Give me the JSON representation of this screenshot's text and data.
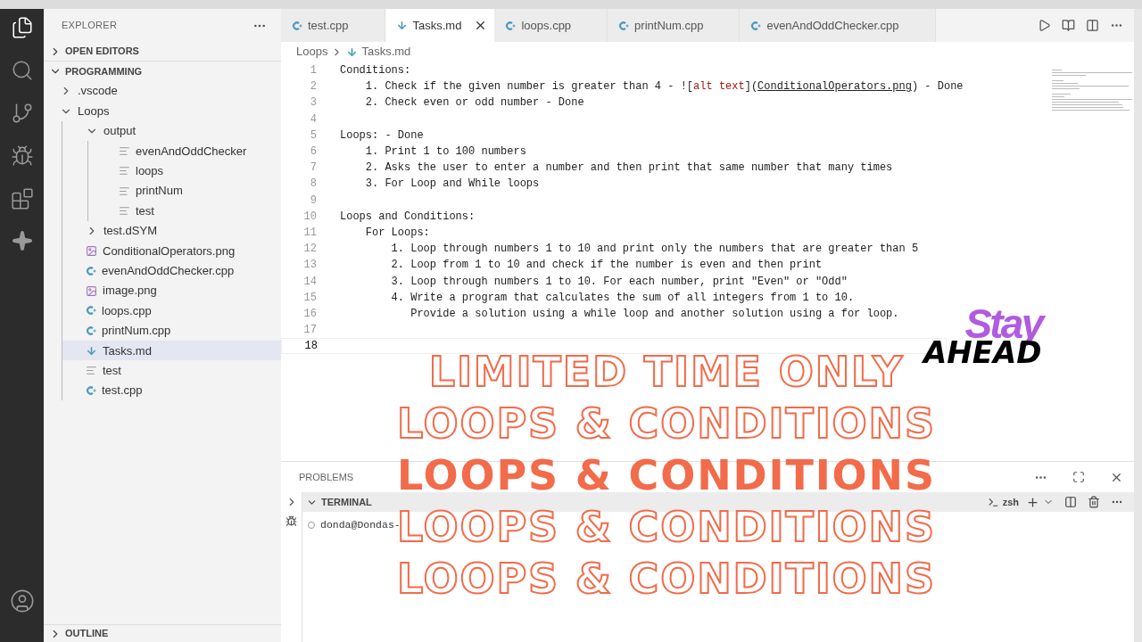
{
  "sidebar": {
    "title": "EXPLORER",
    "sections": [
      {
        "label": "OPEN EDITORS",
        "expanded": false
      },
      {
        "label": "PROGRAMMING",
        "expanded": true
      }
    ],
    "tree": [
      {
        "label": ".vscode",
        "kind": "folder",
        "expanded": false,
        "selected": false
      },
      {
        "label": "Loops",
        "kind": "folder",
        "expanded": true,
        "selected": false,
        "children": [
          {
            "label": "output",
            "kind": "folder",
            "expanded": true,
            "selected": false,
            "children": [
              {
                "label": "evenAndOddChecker",
                "kind": "text",
                "selected": false
              },
              {
                "label": "loops",
                "kind": "text",
                "selected": false
              },
              {
                "label": "printNum",
                "kind": "text",
                "selected": false
              },
              {
                "label": "test",
                "kind": "text",
                "selected": false
              }
            ]
          },
          {
            "label": "test.dSYM",
            "kind": "folder",
            "expanded": false,
            "selected": false
          },
          {
            "label": "ConditionalOperators.png",
            "kind": "image",
            "selected": false
          },
          {
            "label": "evenAndOddChecker.cpp",
            "kind": "cpp",
            "selected": false
          },
          {
            "label": "image.png",
            "kind": "image",
            "selected": false
          },
          {
            "label": "loops.cpp",
            "kind": "cpp",
            "selected": false
          },
          {
            "label": "printNum.cpp",
            "kind": "cpp",
            "selected": false
          },
          {
            "label": "Tasks.md",
            "kind": "markdown",
            "selected": true
          },
          {
            "label": "test",
            "kind": "text",
            "selected": false
          },
          {
            "label": "test.cpp",
            "kind": "cpp",
            "selected": false
          }
        ]
      }
    ],
    "outline": {
      "label": "OUTLINE",
      "expanded": false
    }
  },
  "tabs": [
    {
      "label": "test.cpp",
      "kind": "cpp",
      "selected": false
    },
    {
      "label": "Tasks.md",
      "kind": "markdown",
      "selected": true
    },
    {
      "label": "loops.cpp",
      "kind": "cpp",
      "selected": false
    },
    {
      "label": "printNum.cpp",
      "kind": "cpp",
      "selected": false
    },
    {
      "label": "evenAndOddChecker.cpp",
      "kind": "cpp",
      "selected": false
    }
  ],
  "breadcrumb": [
    {
      "label": "Loops",
      "kind": "folder"
    },
    {
      "label": "Tasks.md",
      "kind": "markdown"
    }
  ],
  "editor": {
    "lines": [
      {
        "number": "1",
        "segments": [
          {
            "kind": "plain",
            "text": "Conditions:"
          }
        ]
      },
      {
        "number": "2",
        "segments": [
          {
            "kind": "plain",
            "text": "    1. Check if the given number is greater than 4 - !["
          },
          {
            "kind": "alt",
            "text": "alt text"
          },
          {
            "kind": "plain",
            "text": "]("
          },
          {
            "kind": "link",
            "text": "ConditionalOperators.png"
          },
          {
            "kind": "plain",
            "text": ") - Done"
          }
        ]
      },
      {
        "number": "3",
        "segments": [
          {
            "kind": "plain",
            "text": "    2. Check even or odd number - Done"
          }
        ]
      },
      {
        "number": "4"
      },
      {
        "number": "5",
        "segments": [
          {
            "kind": "plain",
            "text": "Loops: - Done"
          }
        ]
      },
      {
        "number": "6",
        "segments": [
          {
            "kind": "plain",
            "text": "    1. Print 1 to 100 numbers"
          }
        ]
      },
      {
        "number": "7",
        "segments": [
          {
            "kind": "plain",
            "text": "    2. Asks the user to enter a number and then print that same number that many times"
          }
        ]
      },
      {
        "number": "8",
        "segments": [
          {
            "kind": "plain",
            "text": "    3. For Loop and While loops"
          }
        ]
      },
      {
        "number": "9"
      },
      {
        "number": "10",
        "segments": [
          {
            "kind": "plain",
            "text": "Loops and Conditions:"
          }
        ]
      },
      {
        "number": "11",
        "segments": [
          {
            "kind": "plain",
            "text": "    For Loops:"
          }
        ]
      },
      {
        "number": "12",
        "segments": [
          {
            "kind": "plain",
            "text": "        1. Loop through numbers 1 to 10 and print only the numbers that are greater than 5"
          }
        ]
      },
      {
        "number": "13",
        "segments": [
          {
            "kind": "plain",
            "text": "        2. Loop from 1 to 10 and check if the number is even and then print"
          }
        ]
      },
      {
        "number": "14",
        "segments": [
          {
            "kind": "plain",
            "text": "        3. Loop through numbers 1 to 10. For each number, print \"Even\" or \"Odd\""
          }
        ]
      },
      {
        "number": "15",
        "segments": [
          {
            "kind": "plain",
            "text": "        4. Write a program that calculates the sum of all integers from 1 to 10."
          }
        ]
      },
      {
        "number": "16",
        "segments": [
          {
            "kind": "plain",
            "text": "           Provide a solution using a while loop and another solution using a for loop."
          }
        ]
      },
      {
        "number": "17"
      },
      {
        "number": "18",
        "current": true
      }
    ]
  },
  "panel": {
    "tabs": [
      {
        "label": "PROBLEMS",
        "selected": false
      }
    ],
    "terminal": {
      "title": "TERMINAL",
      "shell": "zsh",
      "prompt": "donda@Dondas-"
    }
  },
  "overlay": {
    "lines": [
      {
        "text": "LIMITED TIME ONLY",
        "kind": "outline"
      },
      {
        "text": "LOOPS & CONDITIONS",
        "kind": "outline"
      },
      {
        "text": "LOOPS & CONDITIONS",
        "kind": "solid"
      },
      {
        "text": "LOOPS & CONDITIONS",
        "kind": "outline"
      },
      {
        "text": "LOOPS & CONDITIONS",
        "kind": "outline"
      }
    ],
    "logo": {
      "top": "Stay",
      "bottom": "AHEAD"
    }
  }
}
